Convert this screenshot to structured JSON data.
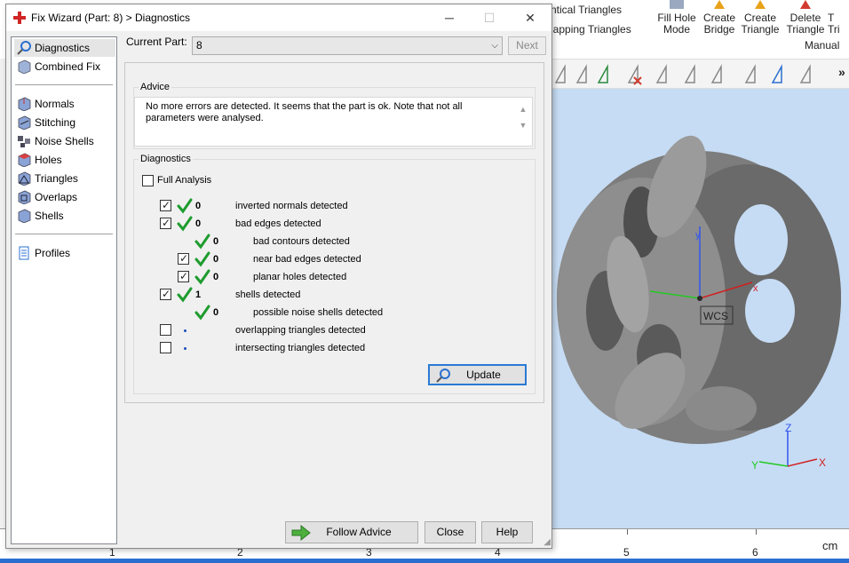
{
  "background_app": {
    "ribbon": {
      "items": [
        "ntical Triangles",
        "lapping Triangles"
      ],
      "buttons": [
        {
          "id": "fill-hole",
          "line1": "Fill Hole",
          "line2": "Mode"
        },
        {
          "id": "create-bridge",
          "line1": "Create",
          "line2": "Bridge"
        },
        {
          "id": "create-triangle",
          "line1": "Create",
          "line2": "Triangle"
        },
        {
          "id": "delete-triangle",
          "line1": "Delete",
          "line2": "Triangle"
        },
        {
          "id": "t-partial",
          "line1": "T",
          "line2": "Tri"
        }
      ],
      "group_label": "Manual",
      "more": "»"
    },
    "viewport": {
      "wcs_label": "WCS",
      "axis_x": "x",
      "axis_y": "y",
      "axis_z": "Z",
      "mini_axis_x": "X",
      "mini_axis_y": "Y",
      "mini_axis_z": "Z"
    },
    "ruler": {
      "numbers": [
        "1",
        "2",
        "3",
        "4",
        "5",
        "6"
      ],
      "unit": "cm"
    },
    "colors": {
      "viewport_bg": "#c6dcf4",
      "accent": "#2a7ad5",
      "green_check": "#1e9c2e"
    }
  },
  "dialog": {
    "title": "Fix Wizard (Part: 8) > Diagnostics",
    "controls": {
      "minimize": "─",
      "maximize": "☐",
      "close": "✕"
    },
    "sidebar": {
      "items": [
        {
          "label": "Diagnostics",
          "icon": "magnifier-icon",
          "selected": true
        },
        {
          "label": "Combined Fix",
          "icon": "cube-icon"
        },
        {
          "label": "Normals",
          "icon": "normals-cube-icon"
        },
        {
          "label": "Stitching",
          "icon": "stitching-cube-icon"
        },
        {
          "label": "Noise Shells",
          "icon": "noise-shells-icon"
        },
        {
          "label": "Holes",
          "icon": "holes-cube-icon"
        },
        {
          "label": "Triangles",
          "icon": "triangle-cube-icon"
        },
        {
          "label": "Overlaps",
          "icon": "overlaps-cube-icon"
        },
        {
          "label": "Shells",
          "icon": "shells-cube-icon"
        },
        {
          "label": "Profiles",
          "icon": "document-icon"
        }
      ]
    },
    "current_part": {
      "label": "Current Part:",
      "value": "8",
      "next_label": "Next"
    },
    "advice": {
      "title": "Advice",
      "text": "No more errors are detected. It seems that the part is ok. Note that not all parameters were analysed."
    },
    "diagnostics": {
      "title": "Diagnostics",
      "full_analysis_label": "Full Analysis",
      "full_analysis_checked": false,
      "rows": [
        {
          "label": "inverted normals detected",
          "count": "0",
          "checked": true,
          "indent": 0,
          "status": "ok"
        },
        {
          "label": "bad edges detected",
          "count": "0",
          "checked": true,
          "indent": 0,
          "status": "ok"
        },
        {
          "label": "bad contours detected",
          "count": "0",
          "checked": null,
          "indent": 1,
          "status": "ok"
        },
        {
          "label": "near bad edges detected",
          "count": "0",
          "checked": true,
          "indent": 1,
          "status": "ok"
        },
        {
          "label": "planar holes detected",
          "count": "0",
          "checked": true,
          "indent": 1,
          "status": "ok"
        },
        {
          "label": "shells detected",
          "count": "1",
          "checked": true,
          "indent": 0,
          "status": "ok"
        },
        {
          "label": "possible noise shells detected",
          "count": "0",
          "checked": null,
          "indent": 1,
          "status": "ok"
        },
        {
          "label": "overlapping triangles detected",
          "count": "",
          "checked": false,
          "indent": 0,
          "status": "none"
        },
        {
          "label": "intersecting triangles detected",
          "count": "",
          "checked": false,
          "indent": 0,
          "status": "none"
        }
      ],
      "update_label": "Update"
    },
    "buttons": {
      "follow_advice": "Follow Advice",
      "close": "Close",
      "help": "Help"
    }
  }
}
